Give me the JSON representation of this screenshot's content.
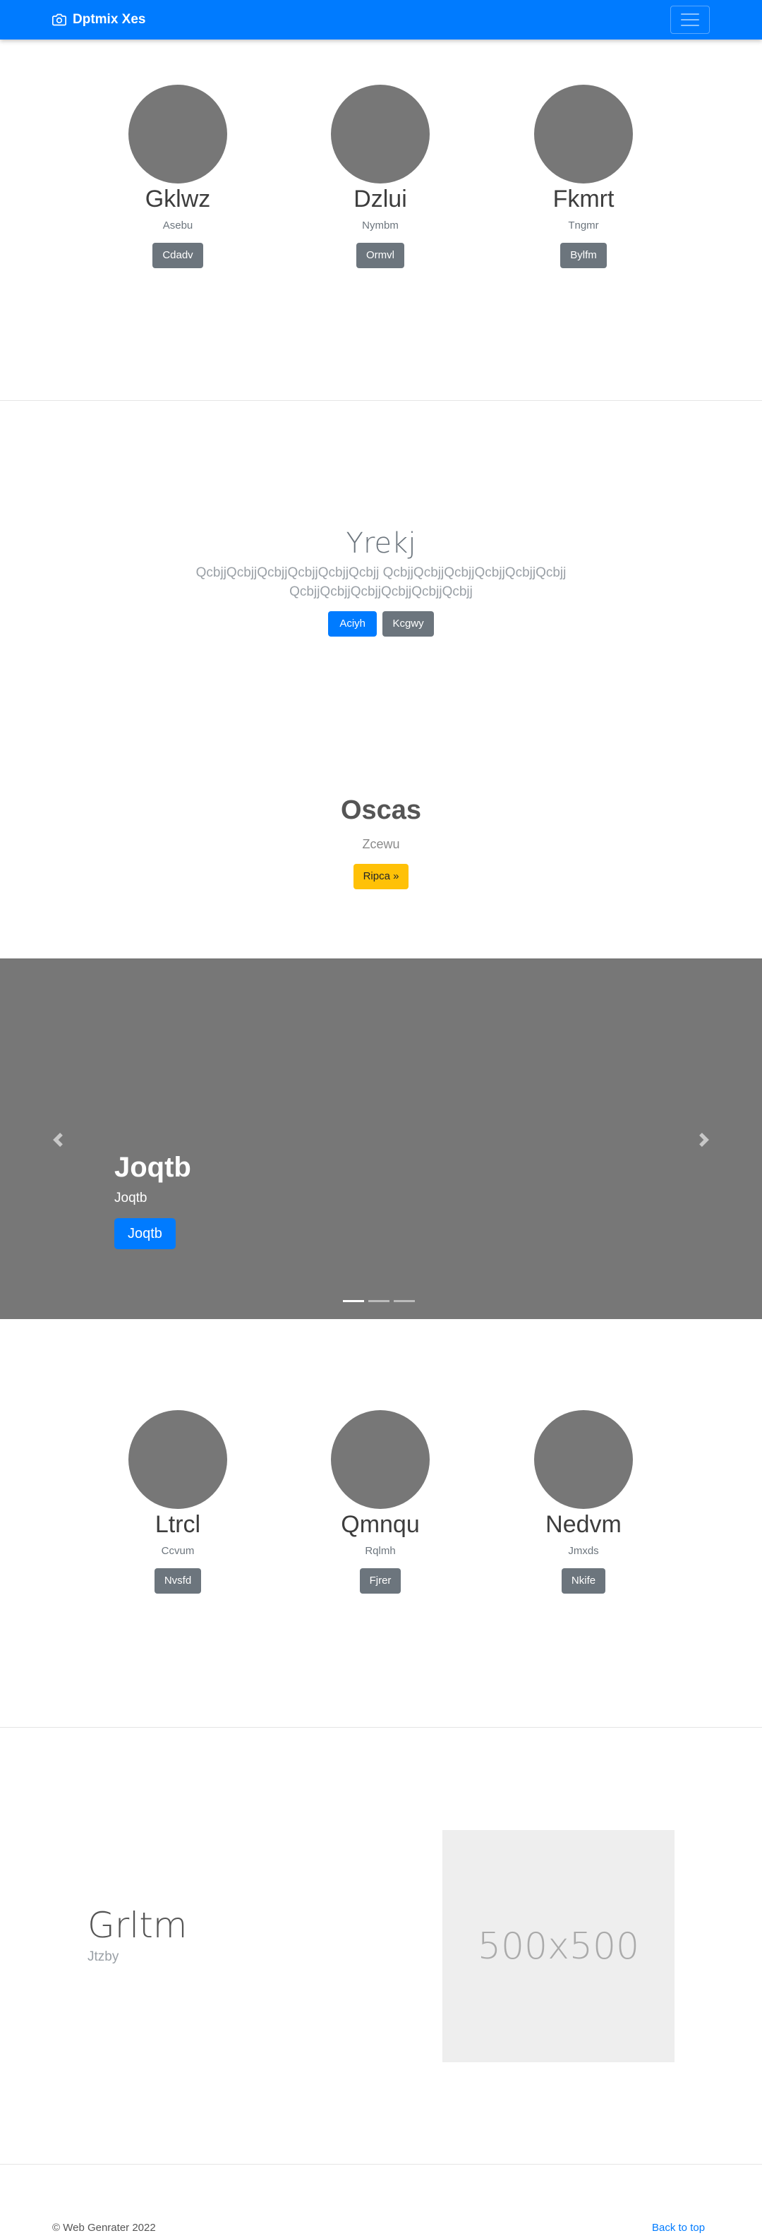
{
  "navbar": {
    "brand": "Dptmix Xes",
    "brand_icon": "camera-icon",
    "toggle_icon": "hamburger-icon"
  },
  "section1": [
    {
      "name": "Gklwz",
      "sub": "Asebu",
      "button": "Cdadv"
    },
    {
      "name": "Dzlui",
      "sub": "Nymbm",
      "button": "Ormvl"
    },
    {
      "name": "Fkmrt",
      "sub": "Tngmr",
      "button": "Bylfm"
    }
  ],
  "hero": {
    "title": "Yrekj",
    "lead": "QcbjjQcbjjQcbjjQcbjjQcbjjQcbjj QcbjjQcbjjQcbjjQcbjjQcbjjQcbjj QcbjjQcbjjQcbjjQcbjjQcbjjQcbjj",
    "primary": "Aciyh",
    "secondary": "Kcgwy"
  },
  "oscas": {
    "title": "Oscas",
    "sub": "Zcewu",
    "button": "Ripca »"
  },
  "carousel": {
    "title": "Joqtb",
    "text": "Joqtb",
    "button": "Joqtb",
    "background": "#777777",
    "slides": 3,
    "active": 0
  },
  "section2": [
    {
      "name": "Ltrcl",
      "sub": "Ccvum",
      "button": "Nvsfd"
    },
    {
      "name": "Qmnqu",
      "sub": "Rqlmh",
      "button": "Fjrer"
    },
    {
      "name": "Nedvm",
      "sub": "Jmxds",
      "button": "Nkife"
    }
  ],
  "featurette": {
    "title": "Grltm",
    "sub": "Jtzby",
    "placeholder": "500x500"
  },
  "footer": {
    "copyright": "© Web Genrater 2022",
    "back_to_top": "Back to top"
  },
  "colors": {
    "primary": "#007bff",
    "secondary": "#6c757d",
    "warning": "#ffc107",
    "placeholder_gray": "#777777"
  }
}
